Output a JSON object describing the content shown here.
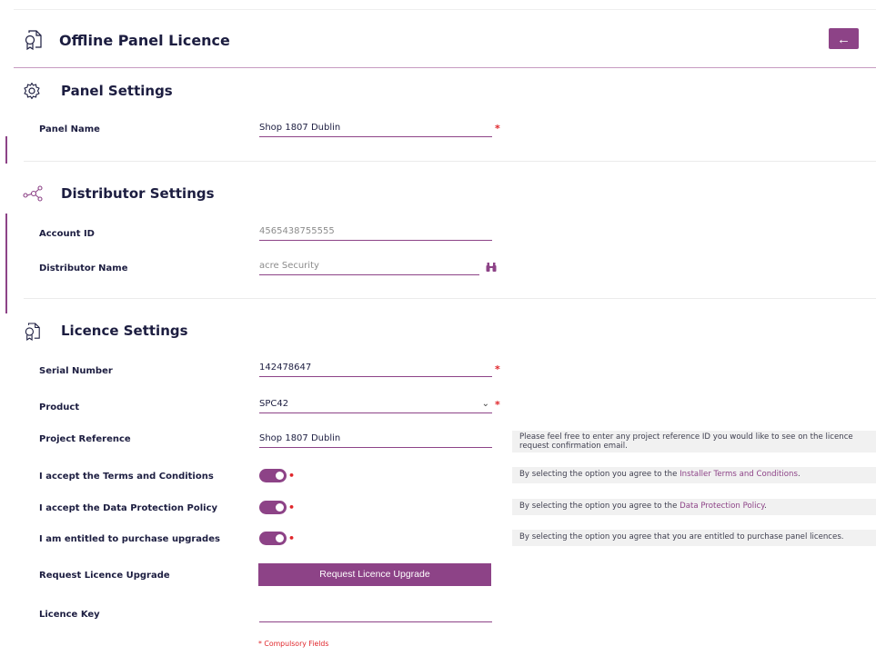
{
  "header": {
    "title": "Offline Panel Licence",
    "back_label": "←"
  },
  "panel_settings": {
    "title": "Panel Settings",
    "panel_name_label": "Panel Name",
    "panel_name_value": "Shop 1807 Dublin"
  },
  "distributor_settings": {
    "title": "Distributor Settings",
    "account_id_label": "Account ID",
    "account_id_value": "4565438755555",
    "distributor_name_label": "Distributor Name",
    "distributor_name_value": "acre Security"
  },
  "licence_settings": {
    "title": "Licence Settings",
    "serial_label": "Serial Number",
    "serial_value": "142478647",
    "product_label": "Product",
    "product_value": "SPC42",
    "project_ref_label": "Project Reference",
    "project_ref_value": "Shop 1807 Dublin",
    "project_ref_help": "Please feel free to enter any project reference ID you would like to see on the licence request confirmation email.",
    "terms_label": "I accept the Terms and Conditions",
    "terms_help_prefix": "By selecting the option you agree to the ",
    "terms_help_link": "Installer Terms and Conditions",
    "terms_help_suffix": ".",
    "dpp_label": "I accept the Data Protection Policy",
    "dpp_help_prefix": "By selecting the option you agree to the ",
    "dpp_help_link": "Data Protection Policy",
    "dpp_help_suffix": ".",
    "upgrades_label": "I am entitled to purchase upgrades",
    "upgrades_help": "By selecting the option you agree that you are entitled to purchase panel licences.",
    "request_upgrade_label": "Request Licence Upgrade",
    "request_upgrade_button": "Request Licence Upgrade",
    "licence_key_label": "Licence Key",
    "licence_key_value": ""
  },
  "required_marker": "*",
  "dot_marker": "•",
  "compulsory_note": "* Compulsory Fields",
  "colors": {
    "accent": "#8d4387",
    "required": "#e0262b",
    "heading": "#1c1d40"
  },
  "icons": {
    "header": "certificate-icon",
    "panel": "gear-icon",
    "distributor": "network-nodes-icon",
    "licence": "certificate-icon",
    "binoculars": "binoculars-icon",
    "dropdown": "chevron-down-icon"
  }
}
